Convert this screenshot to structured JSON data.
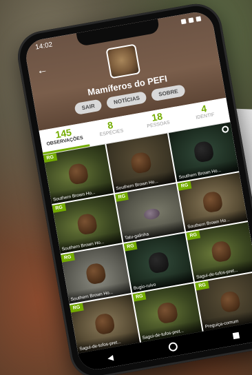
{
  "status_bar": {
    "time": "14:02"
  },
  "header": {
    "back_icon": "arrow-left-icon",
    "project_title": "Mamíferos do PEFI",
    "buttons": [
      {
        "label": "SAIR"
      },
      {
        "label": "NOTÍCIAS"
      },
      {
        "label": "SOBRE"
      }
    ]
  },
  "stats": [
    {
      "value": "145",
      "label": "OBSERVAÇÕES",
      "active": true
    },
    {
      "value": "8",
      "label": "ESPÉCIES",
      "active": false
    },
    {
      "value": "18",
      "label": "PESSOAS",
      "active": false
    },
    {
      "value": "4",
      "label": "IDENTIF",
      "active": false
    }
  ],
  "observations": [
    {
      "badge": "RG",
      "caption": "Southern Brown Ho..."
    },
    {
      "badge": "",
      "caption": "Southern Brown Ho..."
    },
    {
      "badge": "",
      "caption": "Southern Brown Ho..."
    },
    {
      "badge": "RG",
      "caption": "Southern Brown Ho..."
    },
    {
      "badge": "RG",
      "caption": "Tatu-galinha"
    },
    {
      "badge": "RG",
      "caption": "Southern Brown Ho..."
    },
    {
      "badge": "RG",
      "caption": "Southern Brown Ho..."
    },
    {
      "badge": "RG",
      "caption": "Bugio-ruivo"
    },
    {
      "badge": "RG",
      "caption": "Sagui-de-tufos-pret..."
    },
    {
      "badge": "RG",
      "caption": "Sagui-de-tufos-pret..."
    },
    {
      "badge": "RG",
      "caption": "Sagui-de-tufos-pret..."
    },
    {
      "badge": "RG",
      "caption": "Preguiça-comum"
    }
  ],
  "paper_text": "C",
  "colors": {
    "accent": "#74ac00",
    "header_brown": "#6b5344",
    "badge_green": "#74ac00"
  }
}
